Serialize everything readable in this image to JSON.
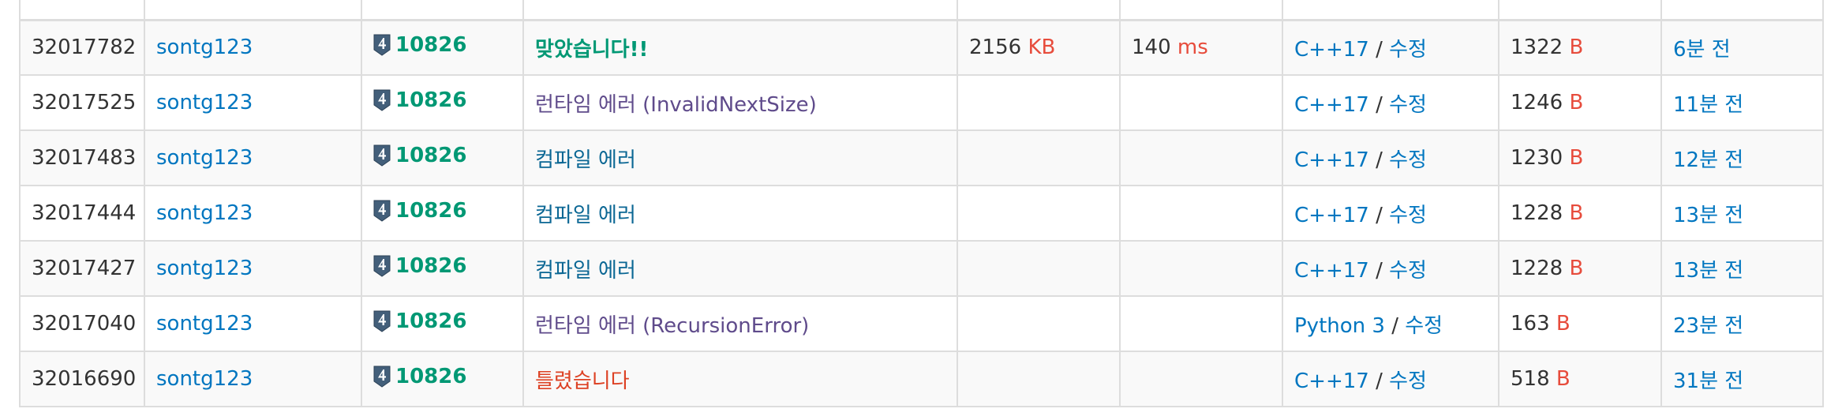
{
  "table": {
    "rows": [
      {
        "id": "32017782",
        "user": "sontg123",
        "problem": "10826",
        "result": "맞았습니다!!",
        "result_class": "res-ac",
        "memory": "2156",
        "memory_unit": "KB",
        "time": "140",
        "time_unit": "ms",
        "lang": "C++17",
        "edit": "수정",
        "length": "1322",
        "length_unit": "B",
        "submitted": "6분 전"
      },
      {
        "id": "32017525",
        "user": "sontg123",
        "problem": "10826",
        "result": "런타임 에러 (InvalidNextSize)",
        "result_class": "res-rte",
        "memory": "",
        "memory_unit": "",
        "time": "",
        "time_unit": "",
        "lang": "C++17",
        "edit": "수정",
        "length": "1246",
        "length_unit": "B",
        "submitted": "11분 전"
      },
      {
        "id": "32017483",
        "user": "sontg123",
        "problem": "10826",
        "result": "컴파일 에러",
        "result_class": "res-ce",
        "memory": "",
        "memory_unit": "",
        "time": "",
        "time_unit": "",
        "lang": "C++17",
        "edit": "수정",
        "length": "1230",
        "length_unit": "B",
        "submitted": "12분 전"
      },
      {
        "id": "32017444",
        "user": "sontg123",
        "problem": "10826",
        "result": "컴파일 에러",
        "result_class": "res-ce",
        "memory": "",
        "memory_unit": "",
        "time": "",
        "time_unit": "",
        "lang": "C++17",
        "edit": "수정",
        "length": "1228",
        "length_unit": "B",
        "submitted": "13분 전"
      },
      {
        "id": "32017427",
        "user": "sontg123",
        "problem": "10826",
        "result": "컴파일 에러",
        "result_class": "res-ce",
        "memory": "",
        "memory_unit": "",
        "time": "",
        "time_unit": "",
        "lang": "C++17",
        "edit": "수정",
        "length": "1228",
        "length_unit": "B",
        "submitted": "13분 전"
      },
      {
        "id": "32017040",
        "user": "sontg123",
        "problem": "10826",
        "result": "런타임 에러 (RecursionError)",
        "result_class": "res-rte",
        "memory": "",
        "memory_unit": "",
        "time": "",
        "time_unit": "",
        "lang": "Python 3",
        "edit": "수정",
        "length": "163",
        "length_unit": "B",
        "submitted": "23분 전"
      },
      {
        "id": "32016690",
        "user": "sontg123",
        "problem": "10826",
        "result": "틀렸습니다",
        "result_class": "res-wa",
        "memory": "",
        "memory_unit": "",
        "time": "",
        "time_unit": "",
        "lang": "C++17",
        "edit": "수정",
        "length": "518",
        "length_unit": "B",
        "submitted": "31분 전"
      }
    ]
  },
  "colors": {
    "link": "#0076c0",
    "unit": "#e74c3c",
    "accepted": "#009874",
    "runtime_error": "#5f4b8b",
    "compile_error": "#0b6794",
    "wrong_answer": "#dd4124",
    "tier_badge": "#435f7a"
  },
  "icons": {
    "tier_badge": "tier-4-shield-icon"
  }
}
